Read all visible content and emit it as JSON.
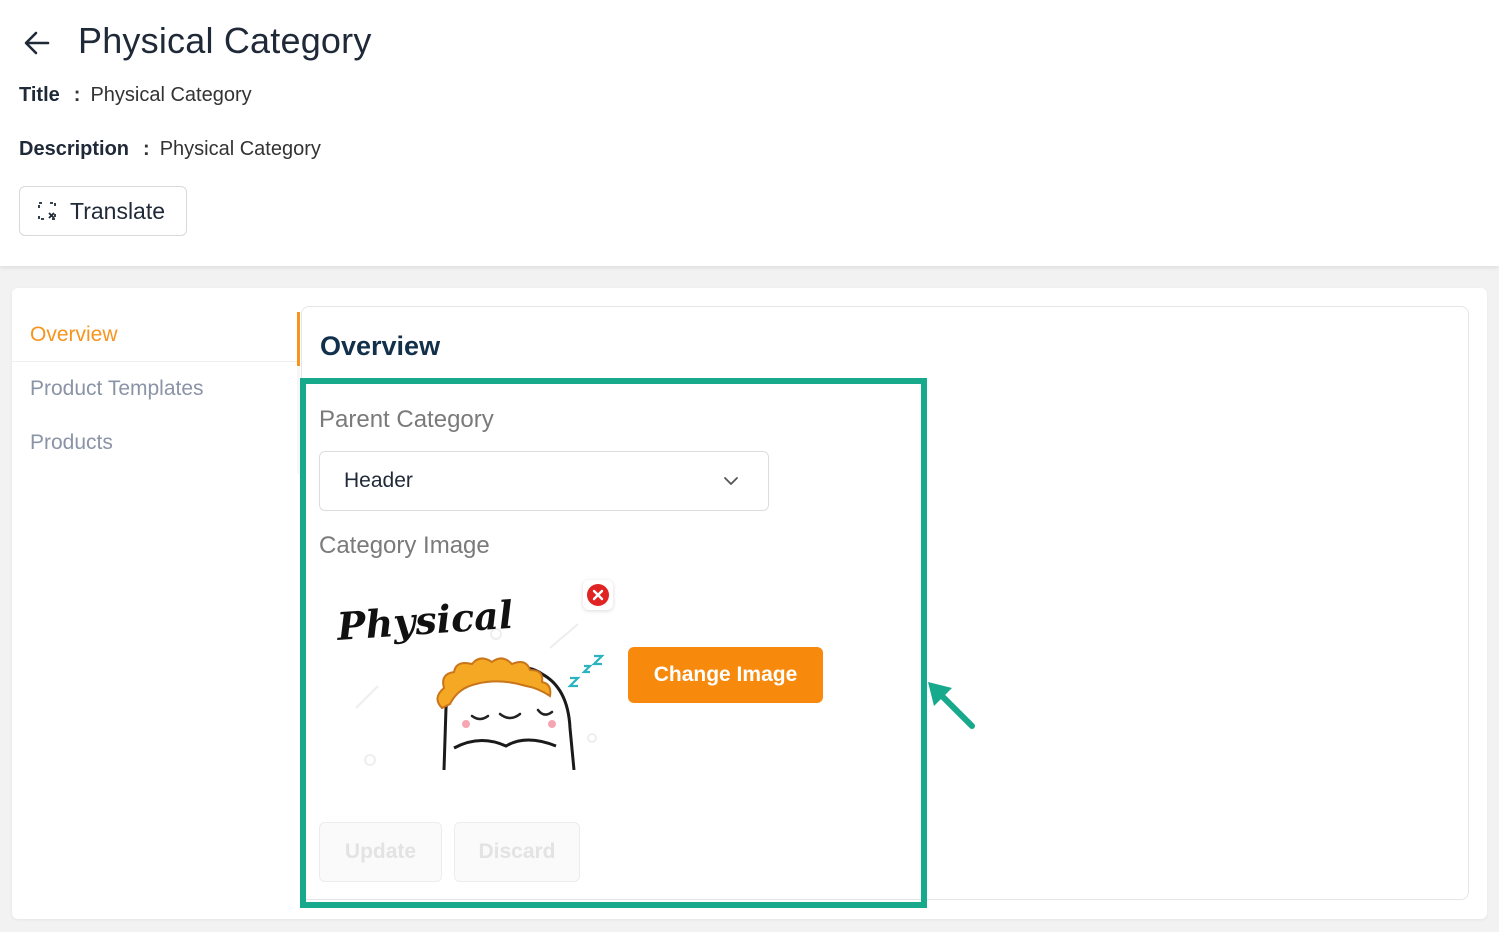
{
  "header": {
    "title": "Physical Category",
    "title_label": "Title",
    "title_value": "Physical Category",
    "description_label": "Description",
    "description_value": "Physical Category",
    "separator": ":",
    "translate_label": "Translate"
  },
  "nav": {
    "items": [
      {
        "label": "Overview",
        "active": true
      },
      {
        "label": "Product Templates",
        "active": false
      },
      {
        "label": "Products",
        "active": false
      }
    ]
  },
  "overview": {
    "title": "Overview",
    "parent_category_label": "Parent Category",
    "parent_category_value": "Header",
    "category_image_label": "Category Image",
    "image_caption": "Physical",
    "change_image_label": "Change Image",
    "update_label": "Update",
    "discard_label": "Discard"
  },
  "colors": {
    "accent": "#f7941d",
    "button": "#f78a0c",
    "highlight": "#16a98c",
    "remove": "#e02424",
    "title": "#12304a"
  },
  "icons": {
    "back": "arrow-left-icon",
    "translate": "translate-icon",
    "dropdown": "chevron-down-icon",
    "remove": "close-circle-icon",
    "pointer": "annotation-arrow-icon"
  }
}
